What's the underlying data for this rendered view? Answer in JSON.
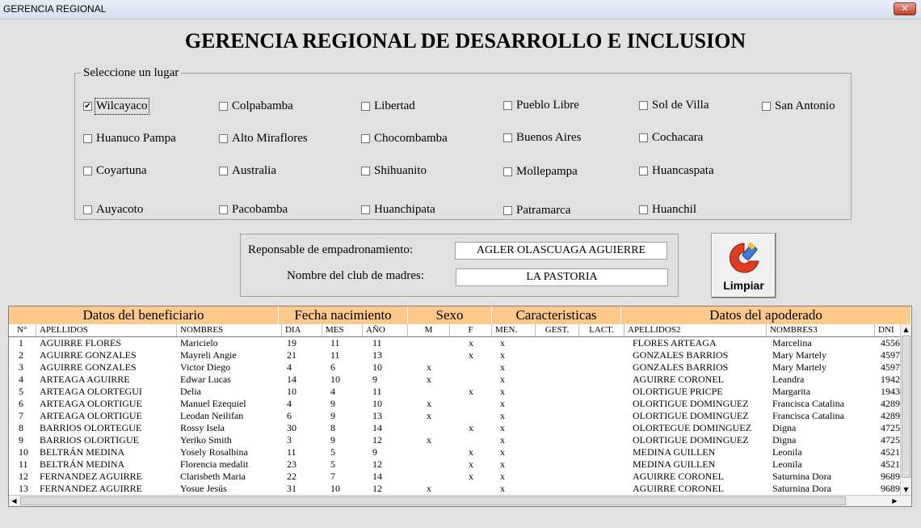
{
  "window": {
    "title": "GERENCIA REGIONAL",
    "close_label": "✕"
  },
  "main_title": "GERENCIA REGIONAL DE DESARROLLO E INCLUSION",
  "lugar": {
    "caption": "Seleccione un lugar",
    "options": [
      {
        "label": "Wilcayaco",
        "checked": true
      },
      {
        "label": "Colpabamba",
        "checked": false
      },
      {
        "label": "Libertad",
        "checked": false
      },
      {
        "label": "Pueblo Libre",
        "checked": false
      },
      {
        "label": "Sol de Villa",
        "checked": false
      },
      {
        "label": "San Antonio",
        "checked": false
      },
      {
        "label": "Huanuco Pampa",
        "checked": false
      },
      {
        "label": "Alto Miraflores",
        "checked": false
      },
      {
        "label": "Chocombamba",
        "checked": false
      },
      {
        "label": "Buenos Aires",
        "checked": false
      },
      {
        "label": "Cochacara",
        "checked": false
      },
      {
        "label": "Coyartuna",
        "checked": false
      },
      {
        "label": "Australia",
        "checked": false
      },
      {
        "label": "Shihuanito",
        "checked": false
      },
      {
        "label": "Mollepampa",
        "checked": false
      },
      {
        "label": "Huancaspata",
        "checked": false
      },
      {
        "label": "Auyacoto",
        "checked": false
      },
      {
        "label": "Pacobamba",
        "checked": false
      },
      {
        "label": "Huanchipata",
        "checked": false
      },
      {
        "label": "Patramarca",
        "checked": false
      },
      {
        "label": "Huanchil",
        "checked": false
      }
    ]
  },
  "info": {
    "responsable_label": "Reponsable de empadronamiento:",
    "responsable_value": "AGLER OLASCUAGA AGUIERRE",
    "club_label": "Nombre del club de madres:",
    "club_value": "LA PASTORIA"
  },
  "limpiar_label": "Limpiar",
  "grid": {
    "groups": [
      "Datos del beneficiario",
      "Fecha nacimiento",
      "Sexo",
      "Caracteristicas",
      "Datos del apoderado"
    ],
    "columns": [
      "N°",
      "APELLIDOS",
      "NOMBRES",
      "DIA",
      "MES",
      "AÑO",
      "M",
      "F",
      "MEN.",
      "GEST.",
      "LACT.",
      "APELLIDOS2",
      "NOMBRES3",
      "DNI"
    ],
    "rows": [
      [
        "1",
        "AGUIRRE FLORES",
        "Maricielo",
        "19",
        "11",
        "11",
        "",
        "x",
        "x",
        "",
        "",
        "FLORES ARTEAGA",
        "Marcelina",
        "4556"
      ],
      [
        "2",
        "AGUIRRE GONZALES",
        "Mayreli Angie",
        "21",
        "11",
        "13",
        "",
        "x",
        "x",
        "",
        "",
        "GONZALES BARRIOS",
        "Mary Martely",
        "4597"
      ],
      [
        "3",
        "AGUIRRE GONZALES",
        "Victor Diego",
        "4",
        "6",
        "10",
        "x",
        "",
        "x",
        "",
        "",
        "GONZALES  BARRIOS",
        "Mary Martely",
        "4597"
      ],
      [
        "4",
        "ARTEAGA AGUIRRE",
        "Edwar Lucas",
        "14",
        "10",
        "9",
        "x",
        "",
        "x",
        "",
        "",
        "AGUIRRE CORONEL",
        "Leandra",
        "1942"
      ],
      [
        "5",
        "ARTEAGA OLORTEGUI",
        "Delia",
        "10",
        "4",
        "11",
        "",
        "x",
        "x",
        "",
        "",
        "OLORTIGUE PRICPE",
        "Margarita",
        "1943"
      ],
      [
        "6",
        "ARTEAGA OLORTIGUE",
        "Manuel Ezequiel",
        "4",
        "9",
        "10",
        "x",
        "",
        "x",
        "",
        "",
        "OLORTIGUE DOMINGUEZ",
        "Francisca Catalina",
        "4289"
      ],
      [
        "7",
        "ARTEAGA OLORTIGUE",
        "Leodan Neilifan",
        "6",
        "9",
        "13",
        "x",
        "",
        "x",
        "",
        "",
        "OLORTIGUE DOMINGUEZ",
        "Francisca Catalina",
        "4289"
      ],
      [
        "8",
        "BARRIOS OLORTEGUE",
        "Rossy Isela",
        "30",
        "8",
        "14",
        "",
        "x",
        "x",
        "",
        "",
        "OLORTEGUE DOMINGUEZ",
        "Digna",
        "4725"
      ],
      [
        "9",
        "BARRIOS OLORTIGUE",
        "Yeriko Smith",
        "3",
        "9",
        "12",
        "x",
        "",
        "x",
        "",
        "",
        "OLORTIGUE DOMINGUEZ",
        "Digna",
        "4725"
      ],
      [
        "10",
        "BELTRÁN MEDINA",
        "Yosely Rosalbina",
        "11",
        "5",
        "9",
        "",
        "x",
        "x",
        "",
        "",
        "MEDINA GUILLEN",
        "Leonila",
        "4521"
      ],
      [
        "11",
        "BELTRÁN MEDINA",
        "Florencia medalit",
        "23",
        "5",
        "12",
        "",
        "x",
        "x",
        "",
        "",
        "MEDINA GUILLEN",
        "Leonila",
        "4521"
      ],
      [
        "12",
        "FERNANDEZ AGUIRRE",
        "Clarisbeth Maria",
        "22",
        "7",
        "14",
        "",
        "x",
        "x",
        "",
        "",
        "AGUIRRE CORONEL",
        "Saturnina Dora",
        "9689"
      ],
      [
        "13",
        "FERNANDEZ AGUIRRE",
        "Yosue Jesús",
        "31",
        "10",
        "12",
        "x",
        "",
        "x",
        "",
        "",
        "AGUIRRE CORONEL",
        "Saturnina Dora",
        "9689"
      ]
    ]
  },
  "colors": {
    "header_orange": "#fcc88c",
    "background": "#e1e1e1"
  }
}
